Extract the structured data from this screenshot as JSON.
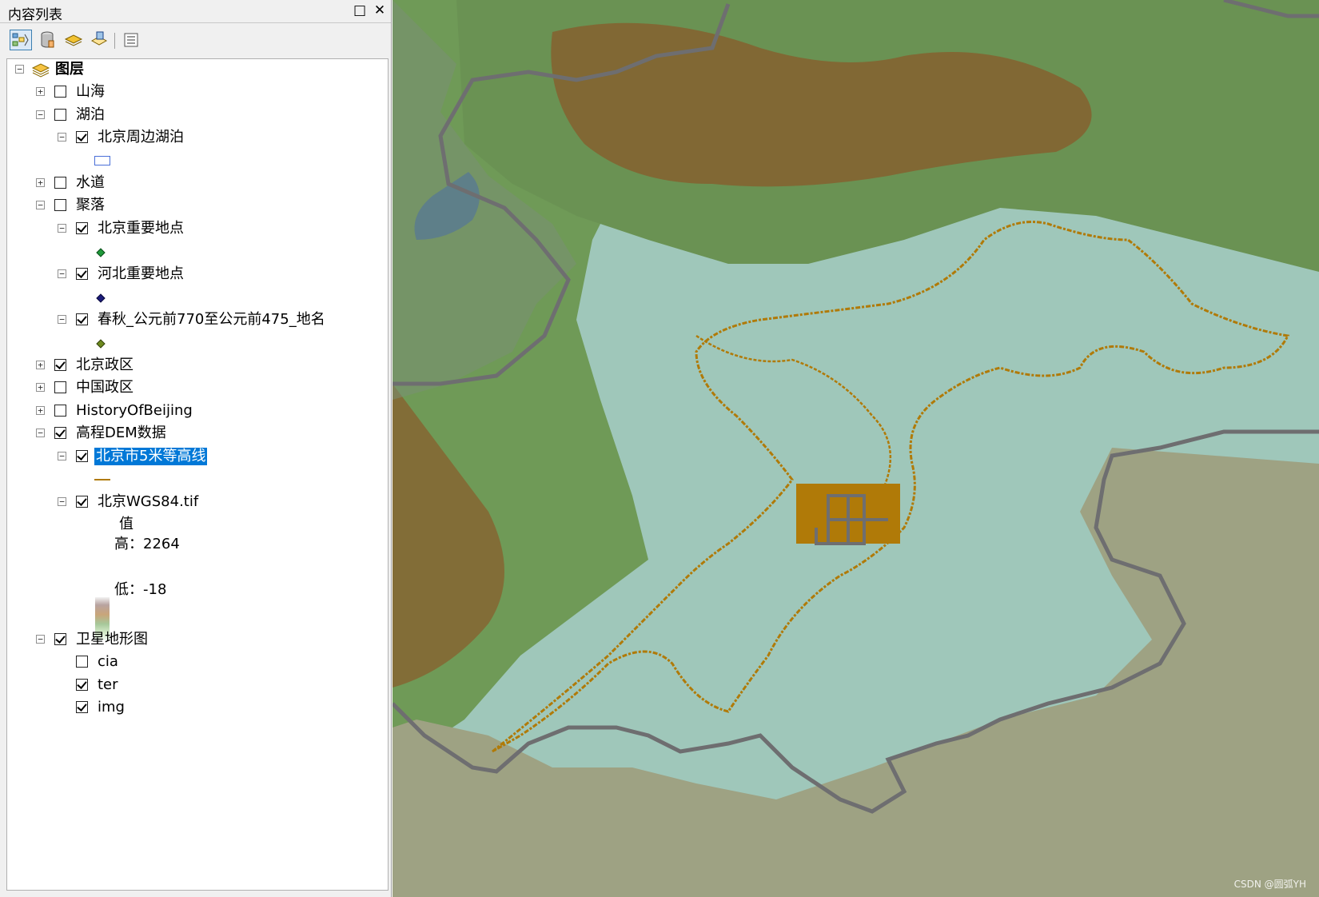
{
  "panel": {
    "title": "内容列表",
    "float_icon": "□",
    "close_icon": "✕"
  },
  "toolbar": {
    "buttons": [
      "list-by-drawing-order-icon",
      "list-by-source-icon",
      "list-by-visibility-icon",
      "list-by-selection-icon",
      "options-icon"
    ]
  },
  "tree": {
    "root": "图层",
    "shanhai": "山海",
    "hupo": "湖泊",
    "beijing_lakes": "北京周边湖泊",
    "shuidao": "水道",
    "juluo": "聚落",
    "bj_places": "北京重要地点",
    "hb_places": "河北重要地点",
    "chunqiu": "春秋_公元前770至公元前475_地名",
    "bj_district": "北京政区",
    "cn_district": "中国政区",
    "history": "HistoryOfBeijing",
    "dem": "高程DEM数据",
    "contour": "北京市5米等高线",
    "tif": "北京WGS84.tif",
    "value_header": "值",
    "high_label": "高：2264",
    "low_label": "低：-18",
    "satellite": "卫星地形图",
    "cia": "cia",
    "ter": "ter",
    "img": "img"
  },
  "map": {
    "credit": "CSDN @圆弧YH",
    "colors": {
      "contour": "#b07a08",
      "boundary": "#6e6e70",
      "plain": "#9cc7bb",
      "mountain": "#8a5a2a"
    }
  }
}
